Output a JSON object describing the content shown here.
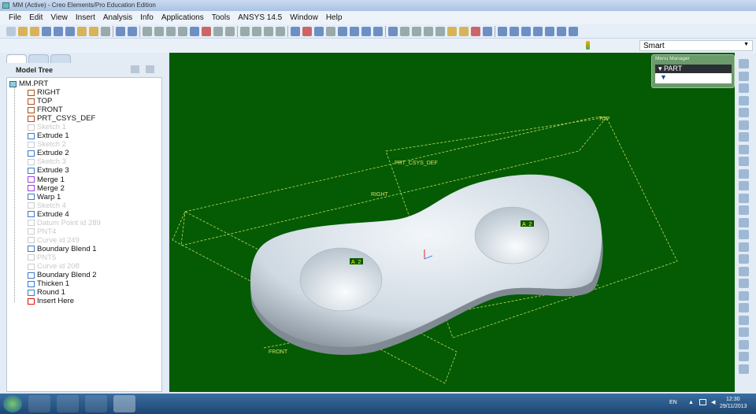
{
  "window": {
    "title": "MM (Active) - Creo Elements/Pro Education Edition"
  },
  "menu": [
    "File",
    "Edit",
    "View",
    "Insert",
    "Analysis",
    "Info",
    "Applications",
    "Tools",
    "ANSYS 14.5",
    "Window",
    "Help"
  ],
  "filter": {
    "value": "Smart"
  },
  "model_tree": {
    "title": "Model Tree",
    "root": "MM.PRT",
    "items": [
      {
        "label": "RIGHT",
        "dim": false,
        "color": "#b0501e"
      },
      {
        "label": "TOP",
        "dim": false,
        "color": "#b0501e"
      },
      {
        "label": "FRONT",
        "dim": false,
        "color": "#b0501e"
      },
      {
        "label": "PRT_CSYS_DEF",
        "dim": false,
        "color": "#b0501e"
      },
      {
        "label": "Sketch 1",
        "dim": true,
        "color": "#ccc"
      },
      {
        "label": "Extrude 1",
        "dim": false,
        "color": "#3a7bc8"
      },
      {
        "label": "Sketch 2",
        "dim": true,
        "color": "#ccc"
      },
      {
        "label": "Extrude 2",
        "dim": false,
        "color": "#3a7bc8"
      },
      {
        "label": "Sketch 3",
        "dim": true,
        "color": "#ccc"
      },
      {
        "label": "Extrude 3",
        "dim": false,
        "color": "#3a7bc8"
      },
      {
        "label": "Merge 1",
        "dim": false,
        "color": "#a040e0"
      },
      {
        "label": "Merge 2",
        "dim": false,
        "color": "#a040e0"
      },
      {
        "label": "Warp 1",
        "dim": false,
        "color": "#3a7bc8"
      },
      {
        "label": "Sketch 4",
        "dim": true,
        "color": "#ccc"
      },
      {
        "label": "Extrude 4",
        "dim": false,
        "color": "#3a7bc8"
      },
      {
        "label": "Datum Point id 289",
        "dim": true,
        "color": "#ccc"
      },
      {
        "label": "PNT4",
        "dim": true,
        "color": "#ccc"
      },
      {
        "label": "Curve id 249",
        "dim": true,
        "color": "#ccc"
      },
      {
        "label": "Boundary Blend 1",
        "dim": false,
        "color": "#3a7bc8"
      },
      {
        "label": "PNT5",
        "dim": true,
        "color": "#ccc"
      },
      {
        "label": "Curve id 208",
        "dim": true,
        "color": "#ccc"
      },
      {
        "label": "Boundary Blend 2",
        "dim": false,
        "color": "#3a7bc8"
      },
      {
        "label": "Thicken 1",
        "dim": false,
        "color": "#3a7bc8"
      },
      {
        "label": "Round 1",
        "dim": false,
        "color": "#3a7bc8"
      },
      {
        "label": "Insert Here",
        "dim": false,
        "color": "#e01010"
      }
    ]
  },
  "viewport": {
    "labels": {
      "top": "TOP",
      "right": "RIGHT",
      "front": "FRONT",
      "csys": "PRT_CSYS_DEF",
      "a1": "A_2",
      "a2": "A_2"
    },
    "background": "#045b04"
  },
  "menu_manager": {
    "title": "Menu Manager",
    "part": "PART"
  },
  "taskbar": {
    "lang": "EN",
    "time": "12:30",
    "date": "29/11/2013"
  }
}
